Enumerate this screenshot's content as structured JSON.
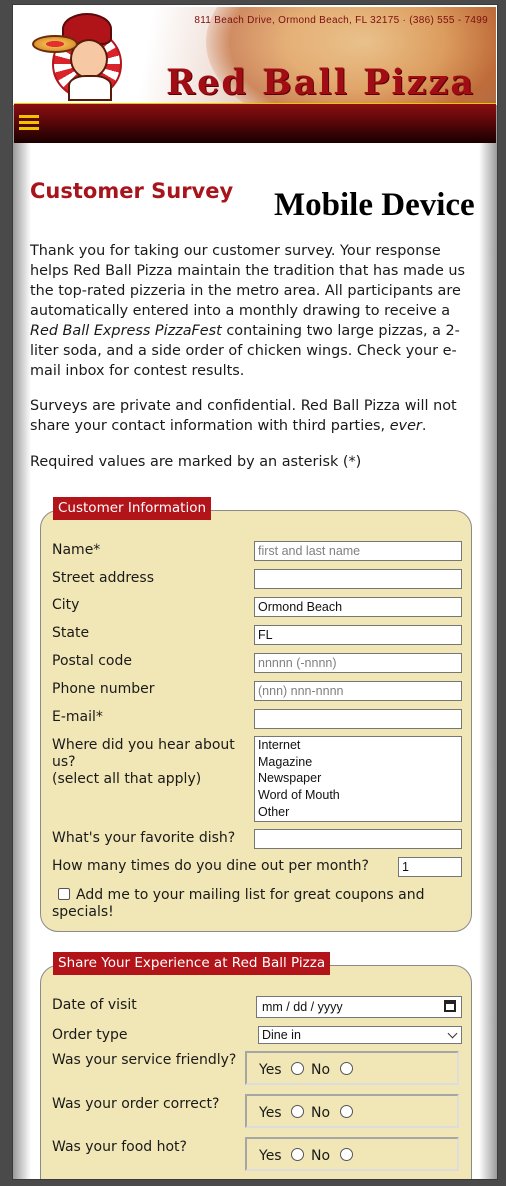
{
  "header": {
    "address": "811 Beach Drive, Ormond Beach, FL 32175 · (386) 555 - 7499",
    "brand": "Red Ball Pizza",
    "menu_icon": "hamburger-menu-icon"
  },
  "main": {
    "title": "Customer Survey",
    "device_label": "Mobile Device",
    "intro": {
      "part1": "Thank you for taking our customer survey. Your response helps Red Ball Pizza maintain the tradition that has made us the top-rated pizzeria in the metro area. All participants are automatically entered into a monthly drawing to receive a ",
      "emphasis": "Red Ball Express PizzaFest",
      "part2": " containing two large pizzas, a 2-liter soda, and a side order of chicken wings. Check your e-mail inbox for contest results."
    },
    "privacy": {
      "part1": "Surveys are private and confidential. Red Ball Pizza will not share your contact information with third parties, ",
      "emphasis": "ever",
      "part2": "."
    },
    "required_note": "Required values are marked by an asterisk (*)"
  },
  "customer_info": {
    "legend": "Customer Information",
    "name": {
      "label": "Name*",
      "placeholder": "first and last name",
      "value": ""
    },
    "street": {
      "label": "Street address",
      "value": ""
    },
    "city": {
      "label": "City",
      "value": "Ormond Beach"
    },
    "state": {
      "label": "State",
      "value": "FL"
    },
    "postal": {
      "label": "Postal code",
      "placeholder": "nnnnn (-nnnn)",
      "value": ""
    },
    "phone": {
      "label": "Phone number",
      "placeholder": "(nnn) nnn-nnnn",
      "value": ""
    },
    "email": {
      "label": "E-mail*",
      "value": ""
    },
    "hear_about": {
      "label_line1": "Where did you hear about",
      "label_line2": "us?",
      "label_line3": "(select all that apply)",
      "options": [
        "Internet",
        "Magazine",
        "Newspaper",
        "Word of Mouth",
        "Other"
      ]
    },
    "favorite_dish": {
      "label": "What's your favorite dish?",
      "value": ""
    },
    "dine_out": {
      "label": "How many times do you dine out per month?",
      "value": "1"
    },
    "mailing_list": {
      "label": "Add me to your mailing list for great coupons and specials!",
      "checked": false
    }
  },
  "experience": {
    "legend": "Share Your Experience at Red Ball Pizza",
    "date": {
      "label": "Date of visit",
      "placeholder": "mm / dd / yyyy"
    },
    "order_type": {
      "label": "Order type",
      "selected": "Dine in"
    },
    "service": {
      "label": "Was your service friendly?",
      "yes": "Yes",
      "no": "No"
    },
    "order_correct": {
      "label": "Was your order correct?",
      "yes": "Yes",
      "no": "No"
    },
    "food_hot": {
      "label": "Was your food hot?",
      "yes": "Yes",
      "no": "No"
    }
  },
  "colors": {
    "brand_red": "#a8141b",
    "legend_red": "#b2141a",
    "fieldset_bg": "#f1e6b5",
    "nav_gold": "#f2c400"
  }
}
